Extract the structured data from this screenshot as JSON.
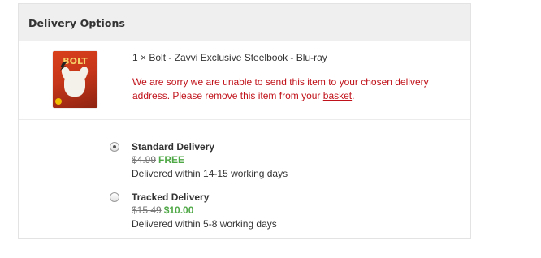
{
  "section": {
    "title": "Delivery Options"
  },
  "item": {
    "quantity_title": "1 × Bolt - Zavvi Exclusive Steelbook - Blu-ray",
    "image_logo_text": "BOLT",
    "warning_text": "We are sorry we are unable to send this item to your chosen delivery address. Please remove this item from your ",
    "warning_link": "basket",
    "warning_end": "."
  },
  "delivery_options": [
    {
      "name": "Standard Delivery",
      "old_price": "$4.99",
      "new_price": "FREE",
      "description": "Delivered within 14-15 working days",
      "selected": true
    },
    {
      "name": "Tracked Delivery",
      "old_price": "$15.49",
      "new_price": "$10.00",
      "description": "Delivered within 5-8 working days",
      "selected": false
    }
  ],
  "colors": {
    "warning": "#c0121a",
    "discount_price": "#4fa846",
    "header_bg": "#efefef"
  }
}
